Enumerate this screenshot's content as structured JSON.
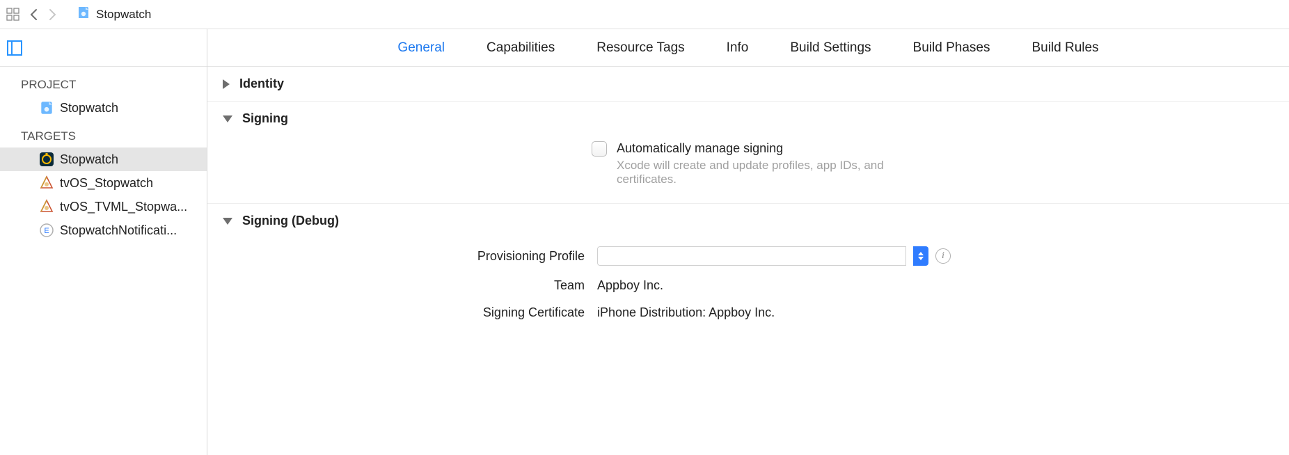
{
  "topbar": {
    "breadcrumb_title": "Stopwatch"
  },
  "sidebar": {
    "project_header": "PROJECT",
    "project_name": "Stopwatch",
    "targets_header": "TARGETS",
    "targets": [
      {
        "label": "Stopwatch"
      },
      {
        "label": "tvOS_Stopwatch"
      },
      {
        "label": "tvOS_TVML_Stopwa..."
      },
      {
        "label": "StopwatchNotificati..."
      }
    ]
  },
  "tabs": [
    {
      "label": "General"
    },
    {
      "label": "Capabilities"
    },
    {
      "label": "Resource Tags"
    },
    {
      "label": "Info"
    },
    {
      "label": "Build Settings"
    },
    {
      "label": "Build Phases"
    },
    {
      "label": "Build Rules"
    }
  ],
  "sections": {
    "identity_title": "Identity",
    "signing_title": "Signing",
    "signing_auto_label": "Automatically manage signing",
    "signing_auto_desc": "Xcode will create and update profiles, app IDs, and certificates.",
    "signing_debug_title": "Signing (Debug)",
    "provisioning_label": "Provisioning Profile",
    "provisioning_value": "",
    "team_label": "Team",
    "team_value": "Appboy Inc.",
    "cert_label": "Signing Certificate",
    "cert_value": "iPhone Distribution: Appboy Inc."
  }
}
